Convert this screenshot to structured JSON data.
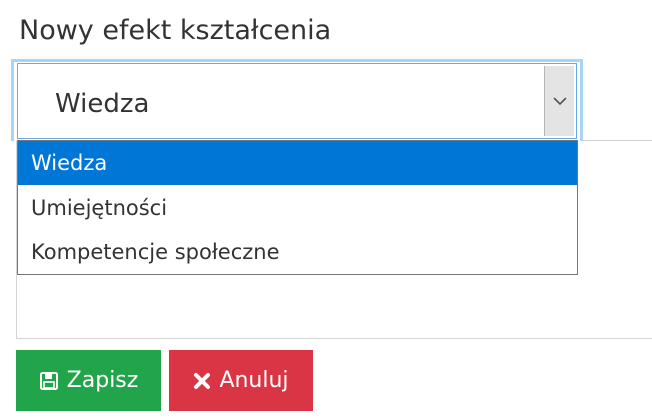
{
  "form": {
    "title": "Nowy efekt kształcenia"
  },
  "category_select": {
    "selected": "Wiedza",
    "options": [
      "Wiedza",
      "Umiejętności",
      "Kompetencje społeczne"
    ],
    "highlighted_index": 0
  },
  "buttons": {
    "save_label": "Zapisz",
    "cancel_label": "Anuluj",
    "save_icon": "floppy-disk-icon",
    "cancel_icon": "x-icon"
  },
  "colors": {
    "save": "#22a44a",
    "cancel": "#d93545",
    "highlight": "#0077d7",
    "focus_ring": "#a8d4f7"
  }
}
